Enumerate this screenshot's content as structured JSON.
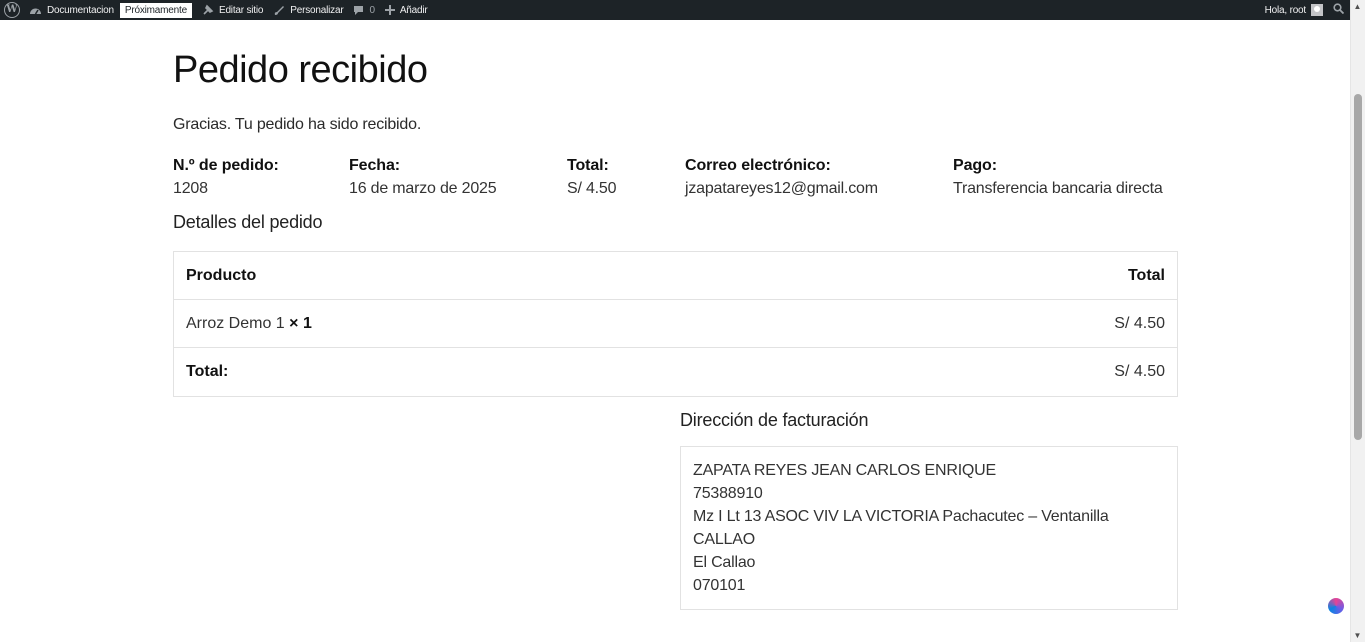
{
  "adminbar": {
    "documentation": "Documentacion",
    "coming_soon": "Próximamente",
    "edit_site": "Editar sitio",
    "customize": "Personalizar",
    "comments_count": "0",
    "add_new": "Añadir",
    "greeting": "Hola, root"
  },
  "page": {
    "title": "Pedido recibido",
    "thanks": "Gracias. Tu pedido ha sido recibido."
  },
  "overview": {
    "order_number": {
      "label": "N.º de pedido:",
      "value": "1208"
    },
    "date": {
      "label": "Fecha:",
      "value": "16 de marzo de 2025"
    },
    "total": {
      "label": "Total:",
      "value": "S/ 4.50"
    },
    "email": {
      "label": "Correo electrónico:",
      "value": "jzapatareyes12@gmail.com"
    },
    "payment": {
      "label": "Pago:",
      "value": "Transferencia bancaria directa"
    }
  },
  "order_details": {
    "title": "Detalles del pedido",
    "header_product": "Producto",
    "header_total": "Total",
    "items": [
      {
        "name": "Arroz Demo 1",
        "qty": "× 1",
        "total": "S/ 4.50"
      }
    ],
    "footer_label": "Total:",
    "footer_value": "S/ 4.50"
  },
  "billing": {
    "title": "Dirección de facturación",
    "lines": [
      "ZAPATA REYES JEAN CARLOS ENRIQUE",
      "75388910",
      "Mz I Lt 13 ASOC VIV LA VICTORIA Pachacutec – Ventanilla",
      "CALLAO",
      "El Callao",
      "070101"
    ]
  }
}
